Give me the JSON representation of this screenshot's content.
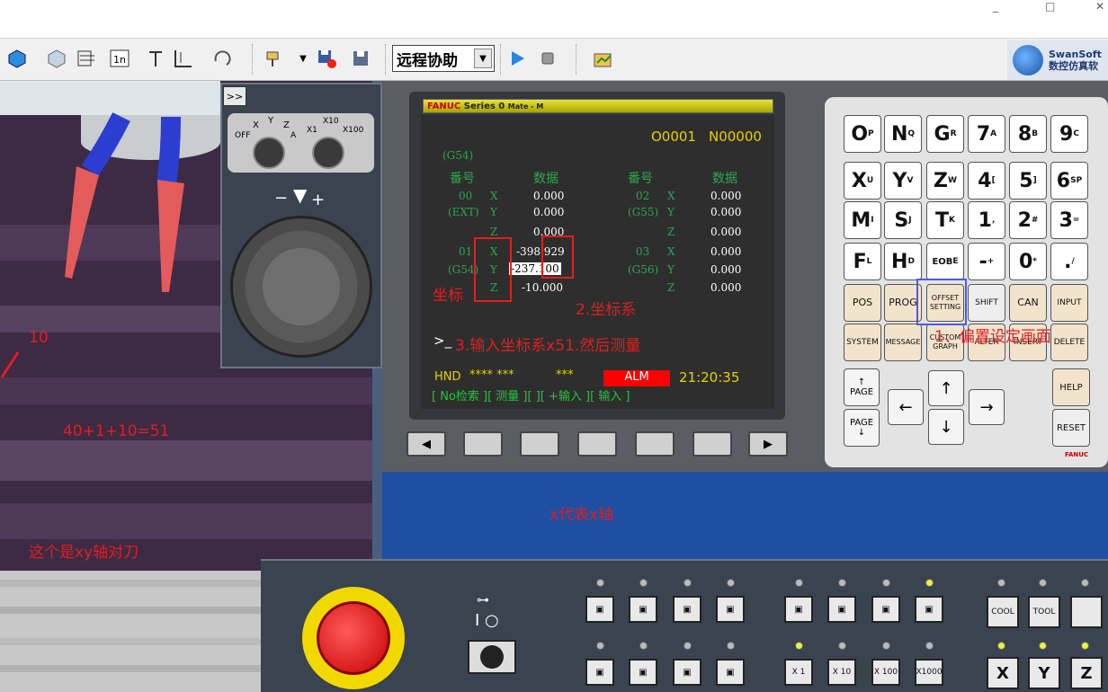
{
  "window": {
    "minimize": "_",
    "maximize": "□",
    "close": "✕"
  },
  "toolbar": {
    "mode_select_value": "远程协助",
    "icons": [
      "cube-icon",
      "shaded-cube-icon",
      "wireframe-icon",
      "tool-view-icon",
      "t-icon",
      "tool-length-icon",
      "rotate-icon",
      "probe-icon",
      "save-red-icon",
      "save-icon",
      "play-icon",
      "stop-icon",
      "chart-icon"
    ]
  },
  "brand": {
    "line1": "SwanSoft",
    "line2": "数控仿真软"
  },
  "mpg": {
    "collapse_label": ">>",
    "axis_labels": {
      "off": "OFF",
      "x": "X",
      "y": "Y",
      "z": "Z",
      "a": "A"
    },
    "scale_labels": {
      "x1": "X1",
      "x10": "X10",
      "x100": "X100"
    },
    "jog_minus": "−",
    "jog_plus": "+"
  },
  "screen": {
    "header_brand": "FANUC",
    "header_series": "Series 0",
    "header_model": "Mate - M",
    "program_no": "O0001",
    "seq_no": "N00000",
    "coord_group": "(G54)",
    "col_no": "番号",
    "col_data": "数据",
    "rows_left": [
      {
        "no": "00",
        "axis": "X",
        "value": "0.000"
      },
      {
        "no": "(EXT)",
        "axis": "Y",
        "value": "0.000"
      },
      {
        "no": "",
        "axis": "Z",
        "value": "0.000"
      },
      {
        "no": "01",
        "axis": "X",
        "value": "-398.929"
      },
      {
        "no": "(G54)",
        "axis": "Y",
        "value": "-237.100"
      },
      {
        "no": "",
        "axis": "Z",
        "value": "-10.000"
      }
    ],
    "rows_right": [
      {
        "no": "02",
        "axis": "X",
        "value": "0.000"
      },
      {
        "no": "(G55)",
        "axis": "Y",
        "value": "0.000"
      },
      {
        "no": "",
        "axis": "Z",
        "value": "0.000"
      },
      {
        "no": "03",
        "axis": "X",
        "value": "0.000"
      },
      {
        "no": "(G56)",
        "axis": "Y",
        "value": "0.000"
      },
      {
        "no": "",
        "axis": "Z",
        "value": "0.000"
      }
    ],
    "prompt": ">_",
    "status_mode": "HND",
    "status_stars": "**** ***",
    "status_stars2": "***",
    "alarm": "ALM",
    "time": "21:20:35",
    "softkeys": "[ No检索 ][ 测量 ][ ][ +输入 ][ 输入 ]"
  },
  "keypad": {
    "rows": [
      [
        "O",
        "N",
        "G",
        "7",
        "8",
        "9"
      ],
      [
        "X",
        "Y",
        "Z",
        "4",
        "5",
        "6"
      ],
      [
        "M",
        "S",
        "T",
        "1",
        "2",
        "3"
      ],
      [
        "F",
        "H",
        "EOB",
        "-",
        "0",
        "."
      ]
    ],
    "subs": [
      [
        "P",
        "Q",
        "R",
        "A",
        "B",
        "C"
      ],
      [
        "U",
        "V",
        "W",
        "[",
        "]",
        "SP"
      ],
      [
        "I",
        "J",
        "K",
        ",",
        "#",
        "="
      ],
      [
        "L",
        "D",
        "E",
        "+",
        "*",
        "/"
      ]
    ],
    "fn_row1": [
      "POS",
      "PROG",
      "OFFSET SETTING",
      "SHIFT",
      "CAN",
      "INPUT"
    ],
    "fn_row2": [
      "SYSTEM",
      "MESSAGE",
      "CUSTOM GRAPH",
      "ALTER",
      "INSERT",
      "DELETE"
    ],
    "page_up": "PAGE",
    "page_down": "PAGE",
    "help": "HELP",
    "reset": "RESET",
    "fanuc_tag": "FANUC"
  },
  "panel": {
    "feed_buttons": [
      "COOL",
      "TOOL",
      ""
    ],
    "multipliers": [
      "X 1",
      "X 10",
      "X 100",
      "X1000"
    ],
    "axes": [
      "X",
      "Y",
      "Z"
    ]
  },
  "annotations": {
    "coord_label": "坐标",
    "coord_system": "2.坐标系",
    "instruction": "3.输入坐标系x51.然后测量",
    "offset_screen": "1、偏置设定画面",
    "calc": "40+1+10=51",
    "ten": "10",
    "x_axis": "x代表x轴",
    "xy_note": "这个是xy轴对刀"
  }
}
